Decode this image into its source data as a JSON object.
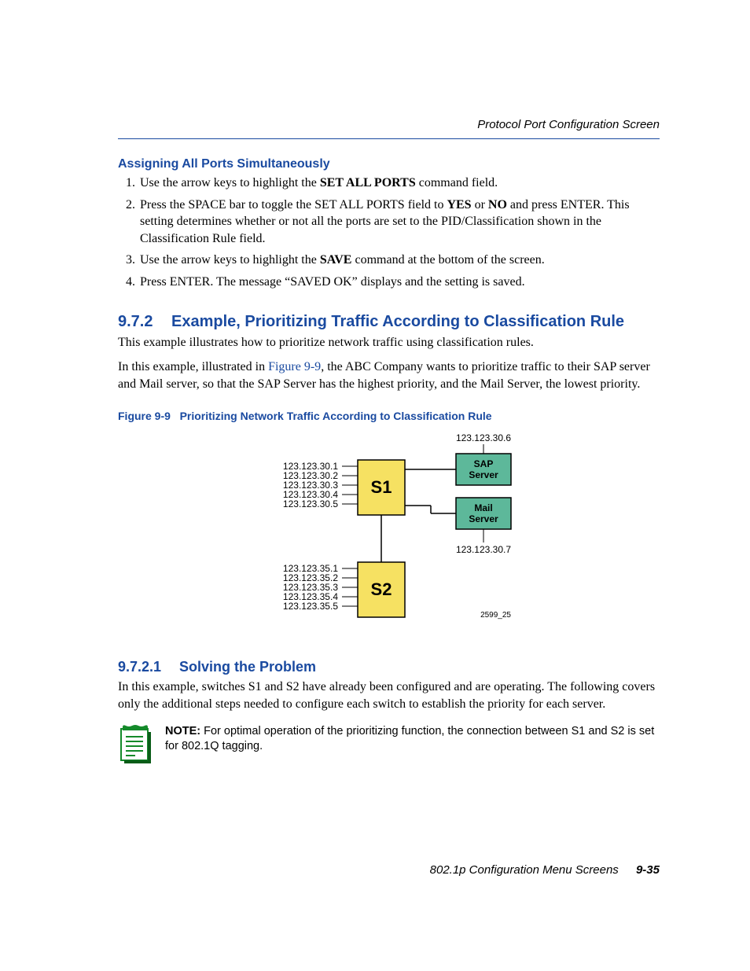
{
  "running_head": "Protocol Port Configuration Screen",
  "section_assign": {
    "title": "Assigning All Ports Simultaneously",
    "steps": {
      "s1a": "Use the arrow keys to highlight the ",
      "s1b": "SET ALL PORTS",
      "s1c": " command field.",
      "s2a": "Press the SPACE bar to toggle the SET ALL PORTS field to ",
      "s2b": "YES",
      "s2c": " or ",
      "s2d": "NO",
      "s2e": " and press ENTER. This setting determines whether or not all the ports are set to the PID/Classification shown in the Classification Rule field.",
      "s3a": "Use the arrow keys to highlight the ",
      "s3b": "SAVE",
      "s3c": " command at the bottom of the screen.",
      "s4": "Press ENTER. The message “SAVED OK” displays and the setting is saved."
    }
  },
  "section_972": {
    "num": "9.7.2",
    "title": "Example, Prioritizing Traffic According to Classification Rule",
    "p1": "This example illustrates how to prioritize network traffic using classification rules.",
    "p2a": "In this example, illustrated in ",
    "p2_ref": "Figure 9-9",
    "p2b": ", the ABC Company wants to prioritize traffic to their SAP server and Mail server, so that the SAP Server has the highest priority, and the Mail Server, the lowest priority."
  },
  "figure": {
    "caption_num": "Figure 9-9",
    "caption_title": "Prioritizing Network Traffic According to Classification Rule",
    "s1_label": "S1",
    "s2_label": "S2",
    "sap_label_1": "SAP",
    "sap_label_2": "Server",
    "mail_label_1": "Mail",
    "mail_label_2": "Server",
    "ip_top": "123.123.30.6",
    "ip_bottom": "123.123.30.7",
    "s1_ips": {
      "a": "123.123.30.1",
      "b": "123.123.30.2",
      "c": "123.123.30.3",
      "d": "123.123.30.4",
      "e": "123.123.30.5"
    },
    "s2_ips": {
      "a": "123.123.35.1",
      "b": "123.123.35.2",
      "c": "123.123.35.3",
      "d": "123.123.35.4",
      "e": "123.123.35.5"
    },
    "artwork_id": "2599_25"
  },
  "section_9721": {
    "num": "9.7.2.1",
    "title": "Solving the Problem",
    "p1": "In this example, switches S1 and S2 have already been configured and are operating. The following covers only the additional steps needed to configure each switch to establish the priority for each server."
  },
  "note": {
    "label": "NOTE:",
    "text": " For optimal operation of the prioritizing function, the connection between S1 and S2 is set for 802.1Q tagging."
  },
  "footer": {
    "title": "802.1p Configuration Menu Screens",
    "page": "9-35"
  }
}
